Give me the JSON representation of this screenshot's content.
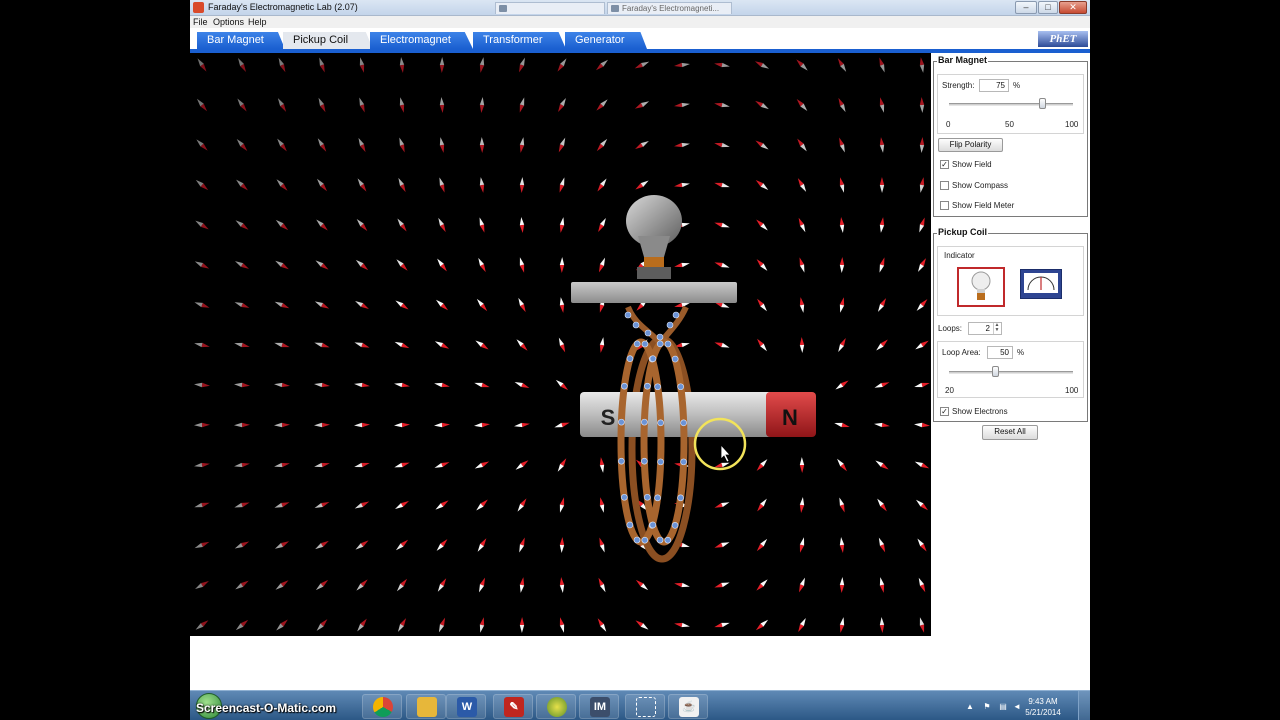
{
  "window": {
    "title": "Faraday's Electromagnetic Lab (2.07)",
    "background_tabs": [
      "",
      "Faraday's Electromagneti..."
    ],
    "controls": {
      "minimize": "–",
      "maximize": "□",
      "close": "✕"
    }
  },
  "menu": {
    "items": [
      "File",
      "Options",
      "Help"
    ]
  },
  "tabs": [
    {
      "label": "Bar Magnet",
      "active": false
    },
    {
      "label": "Pickup Coil",
      "active": true
    },
    {
      "label": "Electromagnet",
      "active": false
    },
    {
      "label": "Transformer",
      "active": false
    },
    {
      "label": "Generator",
      "active": false
    }
  ],
  "logo": "PhET",
  "magnet": {
    "south_label": "S",
    "north_label": "N"
  },
  "bar_magnet_panel": {
    "title": "Bar Magnet",
    "strength": {
      "label": "Strength:",
      "value": "75",
      "unit": "%",
      "fraction": 0.75,
      "min_label": "0",
      "mid_label": "50",
      "max_label": "100"
    },
    "flip_polarity": "Flip Polarity",
    "checkboxes": [
      {
        "label": "Show Field",
        "checked": true
      },
      {
        "label": "Show Compass",
        "checked": false
      },
      {
        "label": "Show Field Meter",
        "checked": false
      }
    ]
  },
  "pickup_coil_panel": {
    "title": "Pickup Coil",
    "indicator_label": "Indicator",
    "indicator_selected": "lightbulb",
    "loops": {
      "label": "Loops:",
      "value": "2"
    },
    "loop_area": {
      "label": "Loop Area:",
      "value": "50",
      "unit": "%",
      "fraction": 0.375,
      "min_label": "20",
      "max_label": "100"
    },
    "show_electrons": {
      "label": "Show Electrons",
      "checked": true
    }
  },
  "reset_all": "Reset All",
  "taskbar": {
    "watermark": "Screencast-O-Matic.com",
    "apps": [
      "chrome-icon",
      "folder-icon",
      "word-icon",
      "acrobat-icon",
      "app-icon",
      "im-icon",
      "snipping-icon",
      "java-icon"
    ],
    "im_label": "IM",
    "clock_time": "9:43 AM",
    "clock_date": "5/21/2014"
  },
  "colors": {
    "tab_blue": "#1a5fd0",
    "magnet_north": "#c7262a",
    "magnet_body": "#bfbfbf",
    "coil": "#9a5b2a",
    "electron": "#6b93d6",
    "cursor_ring": "#f2e35a"
  }
}
